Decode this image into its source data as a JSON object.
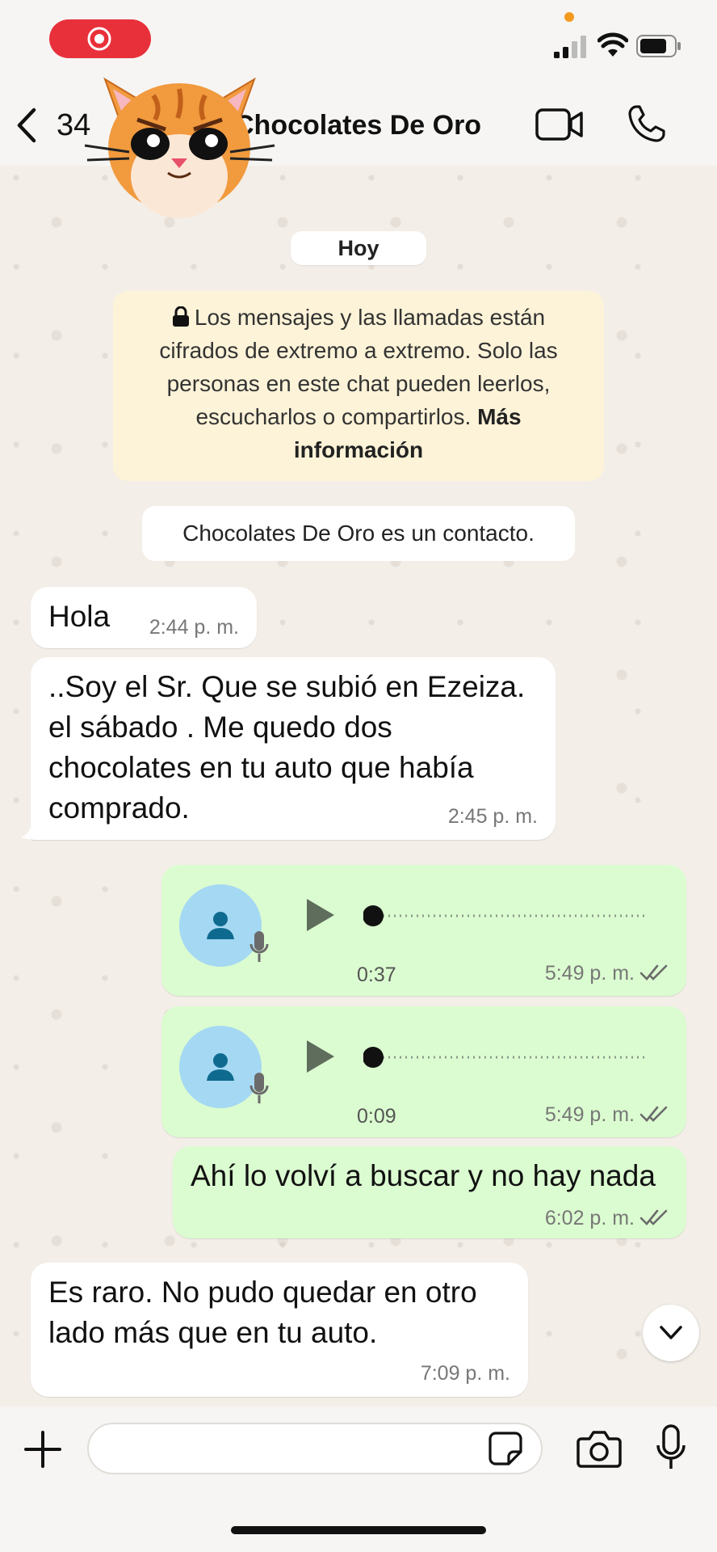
{
  "status_bar": {
    "recording_icon": "screen-record-icon",
    "signal_icon": "signal-icon",
    "wifi_icon": "wifi-icon",
    "battery_icon": "battery-icon"
  },
  "header": {
    "back_count": "34",
    "title": "Chocolates De Oro",
    "video_icon": "video-call-icon",
    "call_icon": "phone-icon"
  },
  "date_pill": "Hoy",
  "encryption_notice": {
    "text": "Los mensajes y las llamadas están cifrados de extremo a extremo. Solo las personas en este chat pueden leerlos, escucharlos o compartirlos.",
    "link": "Más información"
  },
  "contact_notice": "Chocolates De Oro es un contacto.",
  "messages": [
    {
      "direction": "in",
      "text": "Hola",
      "time": "2:44 p. m."
    },
    {
      "direction": "in",
      "text": "..Soy el Sr. Que se subió en Ezeiza. el sábado . Me quedo dos chocolates en tu auto que había comprado.",
      "time": "2:45 p. m."
    },
    {
      "direction": "out",
      "type": "voice",
      "duration": "0:37",
      "time": "5:49 p. m.",
      "status": "read"
    },
    {
      "direction": "out",
      "type": "voice",
      "duration": "0:09",
      "time": "5:49 p. m.",
      "status": "read"
    },
    {
      "direction": "out",
      "text": "Ahí lo volví a buscar y no hay nada",
      "time": "6:02 p. m.",
      "status": "read"
    },
    {
      "direction": "in",
      "text": "Es raro. No  pudo quedar en otro lado más que en tu auto.",
      "time": "7:09 p. m."
    }
  ],
  "composer": {
    "placeholder": "",
    "plus_icon": "plus-icon",
    "sticker_icon": "sticker-icon",
    "camera_icon": "camera-icon",
    "mic_icon": "microphone-icon"
  },
  "colors": {
    "incoming_bubble": "#ffffff",
    "outgoing_bubble": "#dbfcd0",
    "notice_bg": "#fdf3d8",
    "record_pill": "#e8303a",
    "voice_avatar": "#a5d8f3"
  }
}
